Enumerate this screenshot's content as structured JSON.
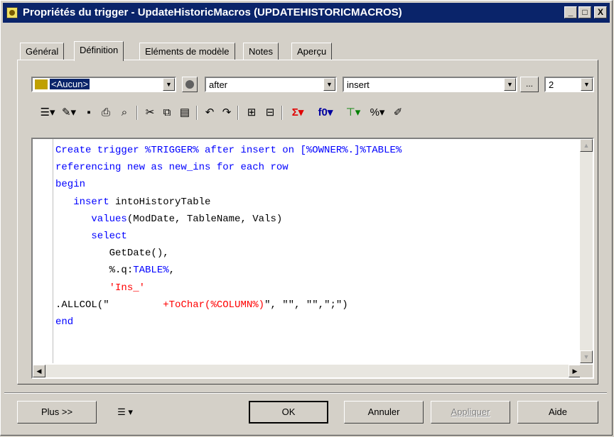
{
  "window": {
    "title": "Propriétés du trigger - UpdateHistoricMacros (UPDATEHISTORICMACROS)",
    "controls": {
      "minimize": "_",
      "maximize": "□",
      "close": "X"
    }
  },
  "tabs": [
    {
      "label": "Général",
      "active": false
    },
    {
      "label": "Définition",
      "active": true
    },
    {
      "label": "Eléments de modèle",
      "active": false
    },
    {
      "label": "Notes",
      "active": false
    },
    {
      "label": "Aperçu",
      "active": false
    }
  ],
  "selectors": {
    "template": {
      "value": "<Aucun>",
      "icon": "template-icon"
    },
    "user_icon": "user-icon",
    "time": {
      "value": "after"
    },
    "event": {
      "value": "insert"
    },
    "ellipsis_label": "...",
    "order": {
      "value": "2"
    }
  },
  "toolbar": {
    "icons": [
      "properties-icon",
      "edit-icon",
      "save-icon",
      "print-icon",
      "find-icon",
      "cut-icon",
      "copy-icon",
      "paste-icon",
      "undo-icon",
      "redo-icon",
      "insert-file-icon",
      "export-file-icon",
      "sigma-icon",
      "function-icon",
      "tree-icon",
      "percent-icon",
      "pencil-icon"
    ],
    "sigma_label": "Σ",
    "function_label": "f0",
    "percent_label": "%"
  },
  "code_lines": [
    [
      {
        "t": "Create trigger %TRIGGER% after insert on [%OWNER%.]%TABLE%",
        "c": "kw"
      }
    ],
    [
      {
        "t": "referencing new as new_ins for each row",
        "c": "kw"
      }
    ],
    [
      {
        "t": "begin",
        "c": "kw"
      }
    ],
    [
      {
        "t": "   insert ",
        "c": "kw"
      },
      {
        "t": "intoHistoryTable",
        "c": "id"
      }
    ],
    [
      {
        "t": "      values",
        "c": "kw"
      },
      {
        "t": "(ModDate, TableName, Vals)",
        "c": "id"
      }
    ],
    [
      {
        "t": "      select",
        "c": "kw"
      }
    ],
    [
      {
        "t": "         GetDate(),",
        "c": "id"
      }
    ],
    [
      {
        "t": "         %.q:",
        "c": "id"
      },
      {
        "t": "TABLE%",
        "c": "kw"
      },
      {
        "t": ",",
        "c": "id"
      }
    ],
    [
      {
        "t": "         'Ins_'",
        "c": "str"
      }
    ],
    [
      {
        "t": ".ALLCOL(\"",
        "c": "id"
      },
      {
        "t": "         +ToChar(%COLUMN%)",
        "c": "str"
      },
      {
        "t": "\", \"\", \"\",\";\")",
        "c": "id"
      }
    ],
    [
      {
        "t": "end",
        "c": "kw"
      }
    ]
  ],
  "colors": {
    "keyword": "#0000ff",
    "string": "#ff0000",
    "titlebar": "#0a246a",
    "face": "#d4d0c8"
  },
  "buttons": {
    "more": "Plus >>",
    "ok": "OK",
    "cancel": "Annuler",
    "apply": "Appliquer",
    "help": "Aide"
  }
}
